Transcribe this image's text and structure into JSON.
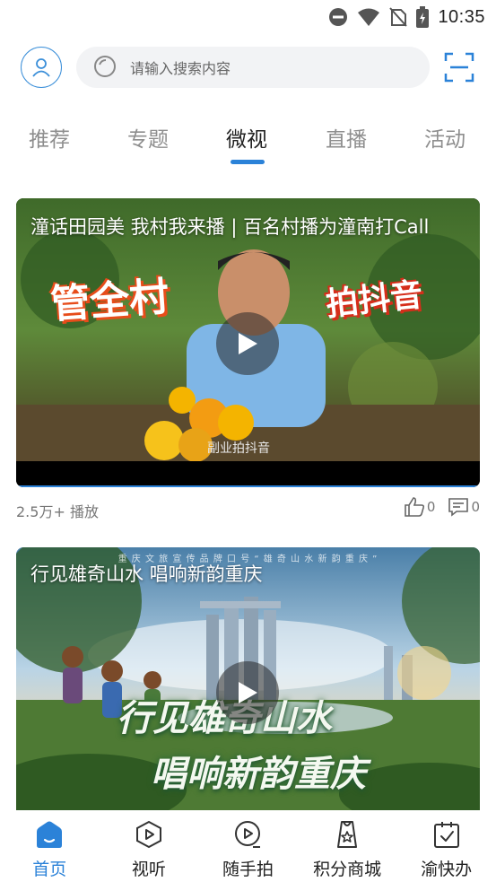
{
  "status_bar": {
    "time": "10:35"
  },
  "search": {
    "placeholder": "请输入搜索内容"
  },
  "tabs": [
    {
      "label": "推荐"
    },
    {
      "label": "专题"
    },
    {
      "label": "微视",
      "active": true
    },
    {
      "label": "直播"
    },
    {
      "label": "活动"
    }
  ],
  "videos": [
    {
      "title": "潼话田园美 我村我来播 | 百名村播为潼南打Call",
      "overlay_left": "管全村",
      "overlay_right": "拍抖音",
      "caption": "副业拍抖音",
      "views": "2.5万+ 播放",
      "likes": "0",
      "comments": "0"
    },
    {
      "title": "行见雄奇山水 唱响新韵重庆",
      "banner": "重 庆 文 旅 宣 传 品 牌 口 号 “ 雄 奇 山 水   新 韵 重 庆 ”",
      "calligraphy_line1": "行见雄奇山水",
      "calligraphy_line2": "唱响新韵重庆"
    }
  ],
  "bottom_nav": [
    {
      "label": "首页",
      "icon": "home-icon",
      "active": true
    },
    {
      "label": "视听",
      "icon": "play-hexagon-icon"
    },
    {
      "label": "随手拍",
      "icon": "video-camera-icon"
    },
    {
      "label": "积分商城",
      "icon": "shopping-bag-star-icon"
    },
    {
      "label": "渝快办",
      "icon": "clipboard-check-icon"
    }
  ],
  "colors": {
    "accent": "#2b82d8",
    "tab_inactive": "#8e8e8e",
    "search_bg": "#f2f3f5"
  }
}
